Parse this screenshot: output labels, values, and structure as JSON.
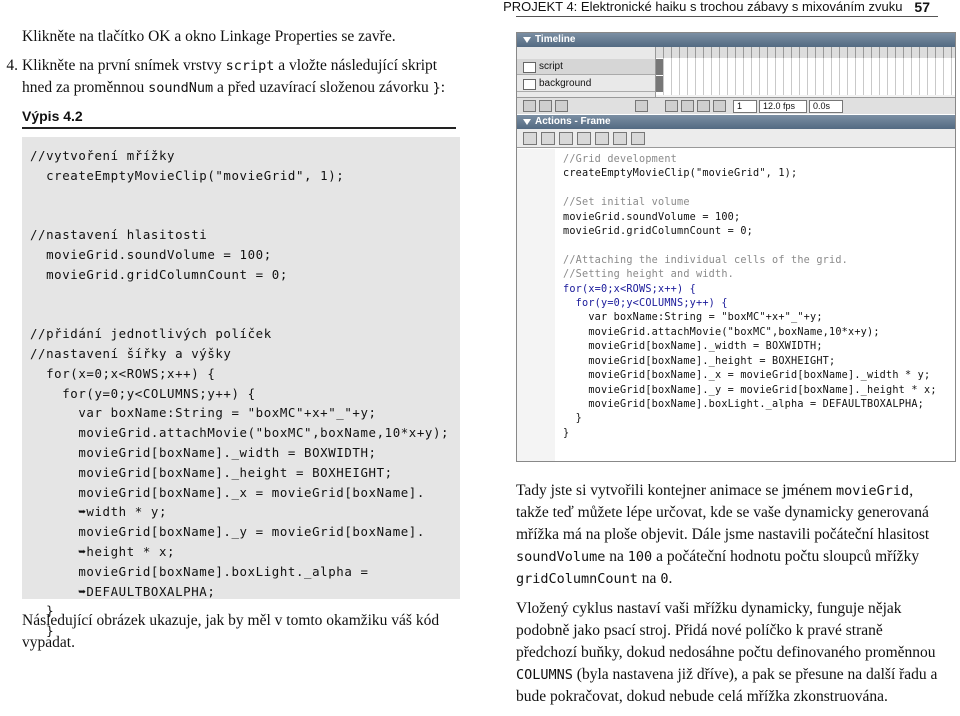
{
  "header": {
    "running_head": "PROJEKT 4: Elektronické haiku s trochou zábavy s mixováním zvuku",
    "page_number": "57"
  },
  "left": {
    "step_intro": "Klikněte na tlačítko OK a okno Linkage Properties se zavře.",
    "step4_num": "4.",
    "step4_a": "Klikněte na první snímek vrstvy ",
    "step4_code1": "script",
    "step4_b": " a vložte následující skript hned za proměnnou ",
    "step4_code2": "soundNum",
    "step4_c": " a před uzavírací složenou závorku ",
    "step4_code3": "}",
    "step4_d": ":",
    "listing_label": "Výpis 4.2",
    "listing_code": "//vytvoření mřížky\n  createEmptyMovieClip(\"movieGrid\", 1);\n\n\n//nastavení hlasitosti\n  movieGrid.soundVolume = 100;\n  movieGrid.gridColumnCount = 0;\n\n\n//přidání jednotlivých políček\n//nastavení šířky a výšky\n  for(x=0;x<ROWS;x++) {\n    for(y=0;y<COLUMNS;y++) {\n      var boxName:String = \"boxMC\"+x+\"_\"+y;\n      movieGrid.attachMovie(\"boxMC\",boxName,10*x+y);\n      movieGrid[boxName]._width = BOXWIDTH;\n      movieGrid[boxName]._height = BOXHEIGHT;\n      movieGrid[boxName]._x = movieGrid[boxName].\n      ➥width * y;\n      movieGrid[boxName]._y = movieGrid[boxName].\n      ➥height * x;\n      movieGrid[boxName].boxLight._alpha =\n      ➥DEFAULTBOXALPHA;\n  }\n  }",
    "after_listing": "Následující obrázek ukazuje, jak by měl v tomto okamžiku váš kód vypadat."
  },
  "right": {
    "p1_a": "Tady jste si vytvořili kontejner animace se jménem ",
    "p1_code1": "movieGrid",
    "p1_b": ", takže teď můžete lépe určovat, kde se vaše dynamicky generovaná mřížka má na ploše objevit. Dále jsme nastavili počáteční hlasitost ",
    "p1_code2": "soundVolume",
    "p1_c": " na ",
    "p1_code3": "100",
    "p1_d": " a počáteční hodnotu počtu sloupců mřížky ",
    "p1_code4": "gridColumnCount",
    "p1_e": " na ",
    "p1_code5": "0",
    "p1_f": ".",
    "p2_a": "Vložený cyklus nastaví vaši mřížku dynamicky, funguje nějak podobně jako psací stroj. Přidá nové políčko k pravé straně předchozí buňky, dokud nedosáhne počtu definovaného proměnnou ",
    "p2_code1": "COLUMNS",
    "p2_b": " (byla nastavena již dříve), a pak se přesune na další řadu a bude pokračovat, dokud nebude celá mřížka zkonstruována."
  },
  "flash_screenshot": {
    "timeline_title": "Timeline",
    "layer_script": "script",
    "layer_background": "background",
    "frame_current": "1",
    "fps": "12.0 fps",
    "time": "0.0s",
    "actions_title": "Actions - Frame",
    "code_lines": [
      {
        "t": "//Grid development",
        "c": "cm"
      },
      {
        "t": "createEmptyMovieClip(\"movieGrid\", 1);",
        "c": ""
      },
      {
        "t": "",
        "c": ""
      },
      {
        "t": "//Set initial volume",
        "c": "cm"
      },
      {
        "t": "movieGrid.soundVolume = 100;",
        "c": ""
      },
      {
        "t": "movieGrid.gridColumnCount = 0;",
        "c": ""
      },
      {
        "t": "",
        "c": ""
      },
      {
        "t": "//Attaching the individual cells of the grid.",
        "c": "cm"
      },
      {
        "t": "//Setting height and width.",
        "c": "cm"
      },
      {
        "t": "for(x=0;x<ROWS;x++) {",
        "c": "kw"
      },
      {
        "t": "  for(y=0;y<COLUMNS;y++) {",
        "c": "kw"
      },
      {
        "t": "    var boxName:String = \"boxMC\"+x+\"_\"+y;",
        "c": ""
      },
      {
        "t": "    movieGrid.attachMovie(\"boxMC\",boxName,10*x+y);",
        "c": ""
      },
      {
        "t": "    movieGrid[boxName]._width = BOXWIDTH;",
        "c": ""
      },
      {
        "t": "    movieGrid[boxName]._height = BOXHEIGHT;",
        "c": ""
      },
      {
        "t": "    movieGrid[boxName]._x = movieGrid[boxName]._width * y;",
        "c": ""
      },
      {
        "t": "    movieGrid[boxName]._y = movieGrid[boxName]._height * x;",
        "c": ""
      },
      {
        "t": "    movieGrid[boxName].boxLight._alpha = DEFAULTBOXALPHA;",
        "c": ""
      },
      {
        "t": "  }",
        "c": ""
      },
      {
        "t": "}",
        "c": ""
      }
    ]
  }
}
